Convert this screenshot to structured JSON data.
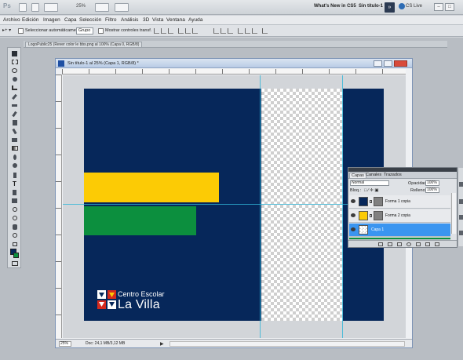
{
  "appbar": {
    "logo": "Ps",
    "zoom": "25%",
    "whats_new": "What's New in CS5",
    "document_title": "Sin título-1",
    "cs_live": "CS Live"
  },
  "menu": [
    "Archivo",
    "Edición",
    "Imagen",
    "Capa",
    "Selección",
    "Filtro",
    "Análisis",
    "3D",
    "Vista",
    "Ventana",
    "Ayuda"
  ],
  "options": {
    "auto_select_label": "Seleccionar automáticamente:",
    "auto_select_value": "Grupo",
    "show_controls_label": "Mostrar controles transf."
  },
  "doc_tab": "LogoPublic25 (Rever color le bbs.png al 100% (Capa 0, RGB/8)",
  "document": {
    "title": "Sin título-1 al 25% (Capa 1, RGB/8) *",
    "status_zoom": "25%",
    "status_doc": "Doc: 24,1 MB/3,12 MB",
    "logo_line1": "Centro Escolar",
    "logo_line2": "La Villa"
  },
  "layers_panel": {
    "tabs": [
      "Capas",
      "Canales",
      "Trazados"
    ],
    "blend_mode": "Normal",
    "opacity_label": "Opacidad:",
    "opacity_value": "100%",
    "lock_label": "Bloq.:",
    "fill_label": "Relleno:",
    "fill_value": "100%",
    "layers": [
      {
        "name": "Forma 1 copia",
        "thumb_color": "#06275a",
        "selected": false
      },
      {
        "name": "Forma 2 copia",
        "thumb_color": "#fccb05",
        "selected": false
      },
      {
        "name": "Capa 1",
        "thumb_color": "transparent",
        "selected": true
      }
    ]
  },
  "colors": {
    "navy": "#06275a",
    "yellow": "#fccb05",
    "green": "#0c8f3e",
    "red": "#d52b1e",
    "selection": "#3a95f0",
    "guide": "#2fb5d7"
  },
  "icons": {
    "tools": [
      "move-icon",
      "marquee-icon",
      "lasso-icon",
      "quick-select-icon",
      "crop-icon",
      "eyedropper-icon",
      "healing-brush-icon",
      "brush-icon",
      "clone-stamp-icon",
      "history-brush-icon",
      "eraser-icon",
      "gradient-icon",
      "blur-icon",
      "dodge-icon",
      "pen-icon",
      "type-icon",
      "path-select-icon",
      "shape-icon",
      "3d-rotate-icon",
      "3d-camera-icon",
      "hand-icon",
      "zoom-icon",
      "default-colors-icon",
      "foreground-color-icon",
      "quick-mask-icon",
      "screen-mode-icon"
    ]
  }
}
